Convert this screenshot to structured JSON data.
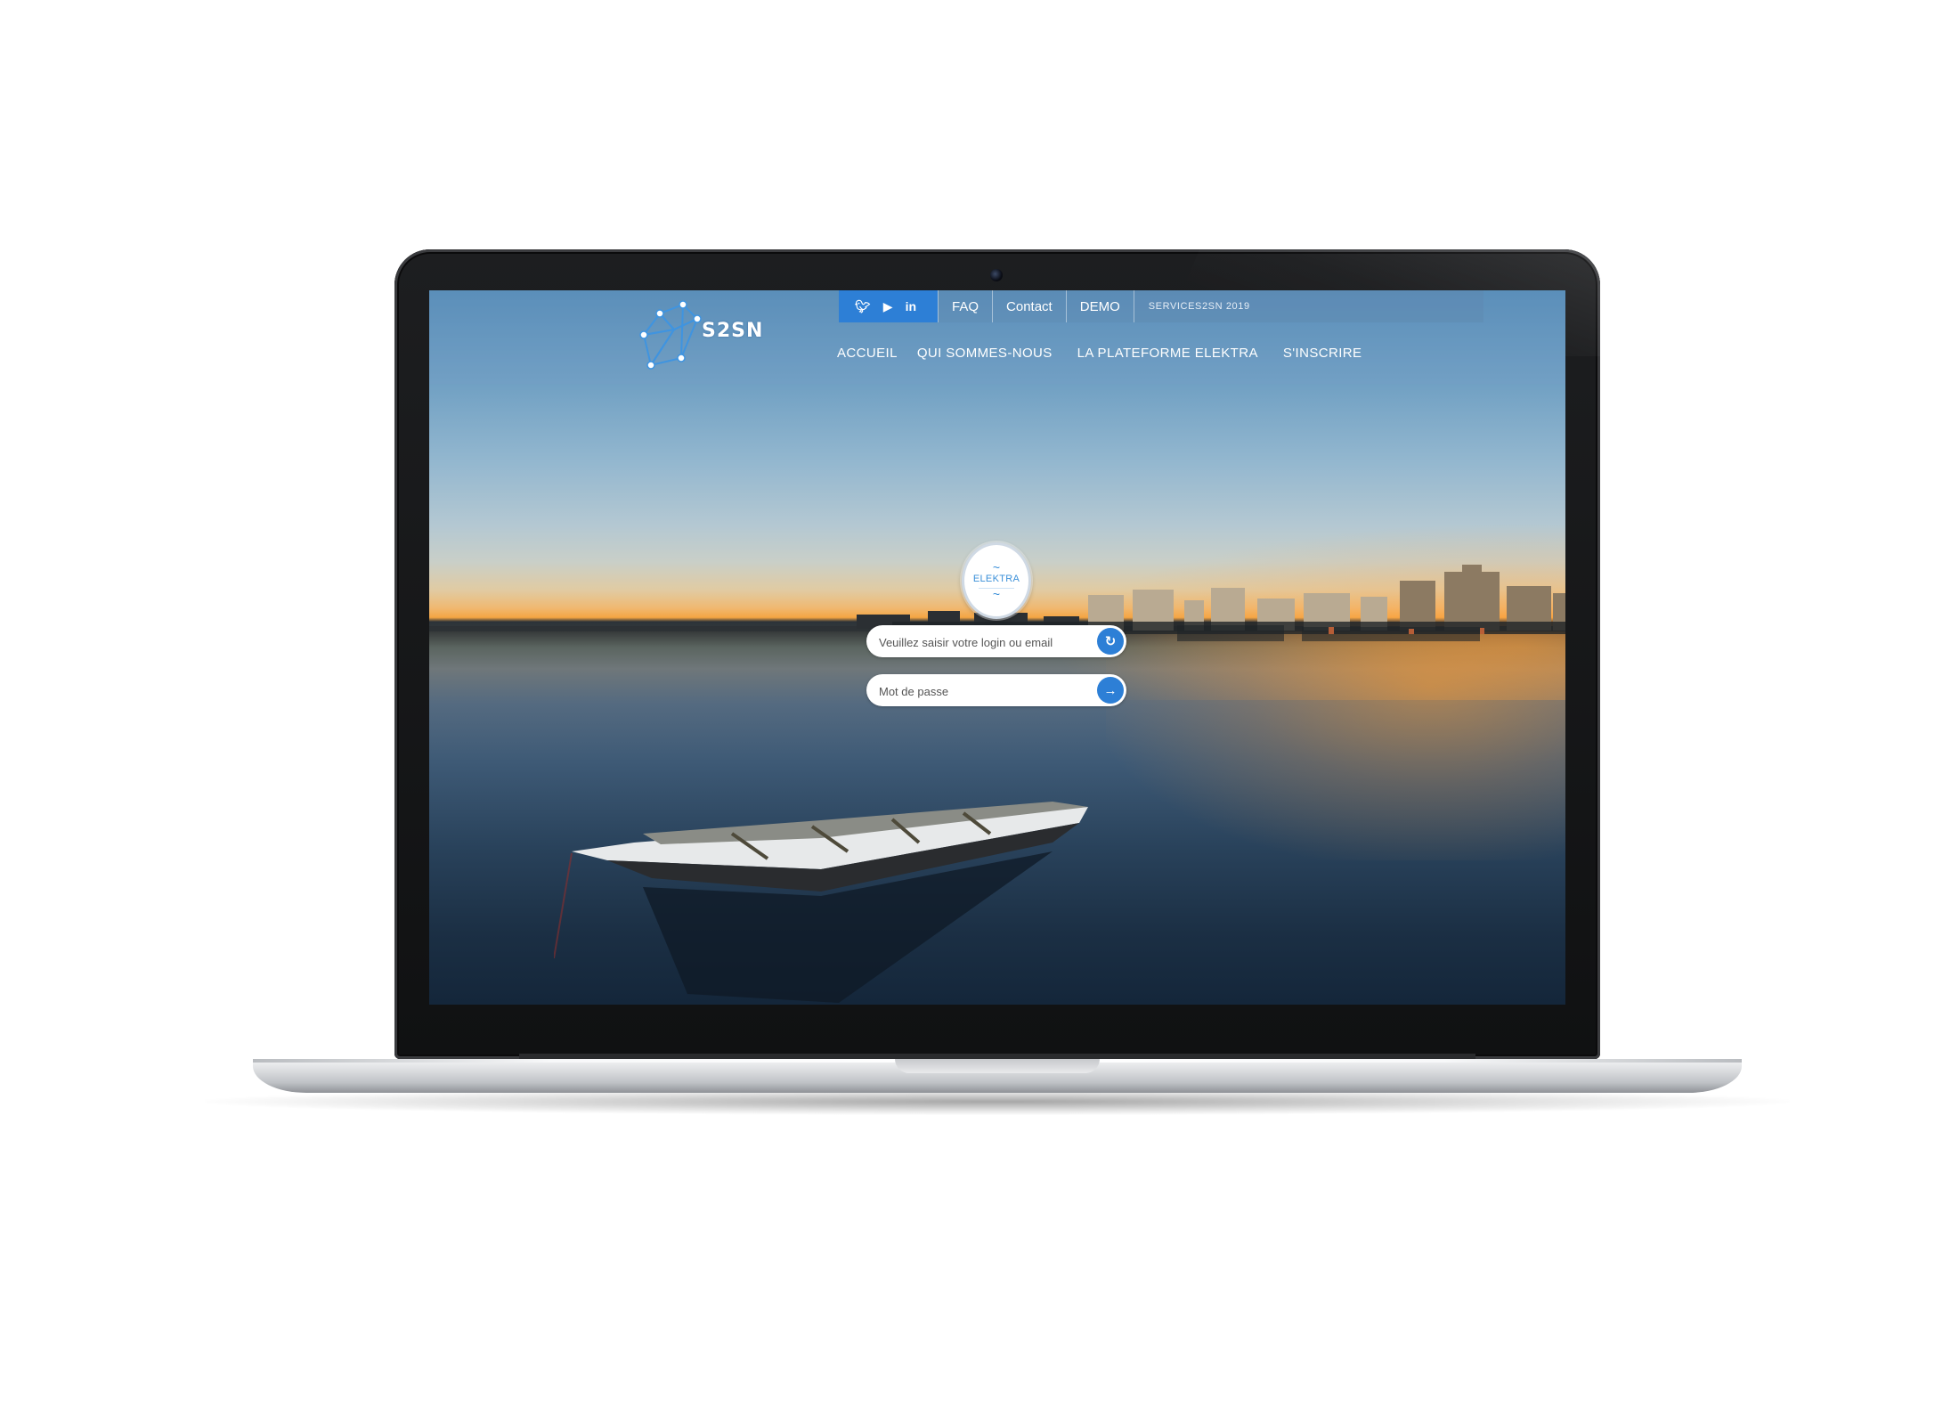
{
  "brand": {
    "logo_text": "S2SN",
    "accent_color": "#2d7fd6"
  },
  "topbar": {
    "social": [
      {
        "name": "twitter-icon",
        "glyph": "🐦︎"
      },
      {
        "name": "youtube-icon",
        "glyph": "▶"
      },
      {
        "name": "linkedin-icon",
        "glyph": "in"
      }
    ],
    "links": [
      {
        "name": "faq",
        "label": "FAQ"
      },
      {
        "name": "contact",
        "label": "Contact"
      },
      {
        "name": "demo",
        "label": "DEMO"
      }
    ],
    "copyright": "SERVICES2SN 2019"
  },
  "nav": {
    "items": [
      {
        "name": "accueil",
        "label": "ACCUEIL"
      },
      {
        "name": "qui-sommes-nous",
        "label": "QUI SOMMES-NOUS"
      },
      {
        "name": "plateforme-elektra",
        "label": "LA PLATEFORME ELEKTRA"
      },
      {
        "name": "inscrire",
        "label": "S'INSCRIRE"
      }
    ]
  },
  "login": {
    "badge_title": "ELEKTRA",
    "login_placeholder": "Veuillez saisir votre login ou email",
    "password_placeholder": "Mot de passe",
    "reset_icon": "↻",
    "submit_icon": "→"
  }
}
